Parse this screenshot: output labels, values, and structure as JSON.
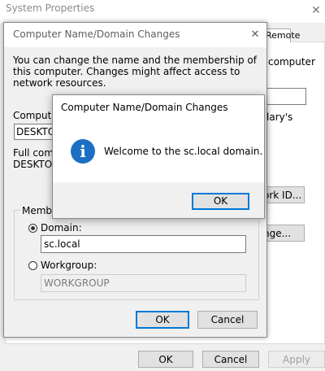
{
  "system_properties": {
    "title": "System Properties",
    "close_label": "✕",
    "tab_remote": "Remote",
    "text_computer_fragment": "computer",
    "text_library_fragment": "lary's",
    "network_id_button_fragment": "ork ID...",
    "change_button_fragment": "nge...",
    "buttons": {
      "ok": "OK",
      "cancel": "Cancel",
      "apply": "Apply"
    }
  },
  "computer_name_dialog": {
    "title": "Computer Name/Domain Changes",
    "close_label": "✕",
    "description": "You can change the name and the membership of this computer. Changes might affect access to network resources.",
    "computer_name_label": "Computer",
    "computer_name_value": "DESKTO",
    "full_name_label": "Full compu",
    "full_name_value": "DESKTOP",
    "member_of_label": "Member",
    "domain_label": "Domain:",
    "domain_value": "sc.local",
    "domain_selected": true,
    "workgroup_label": "Workgroup:",
    "workgroup_value": "WORKGROUP",
    "buttons": {
      "ok": "OK",
      "cancel": "Cancel"
    }
  },
  "message_box": {
    "title": "Computer Name/Domain Changes",
    "icon": "info-icon",
    "icon_glyph": "i",
    "message": "Welcome to the sc.local domain.",
    "ok_label": "OK"
  }
}
